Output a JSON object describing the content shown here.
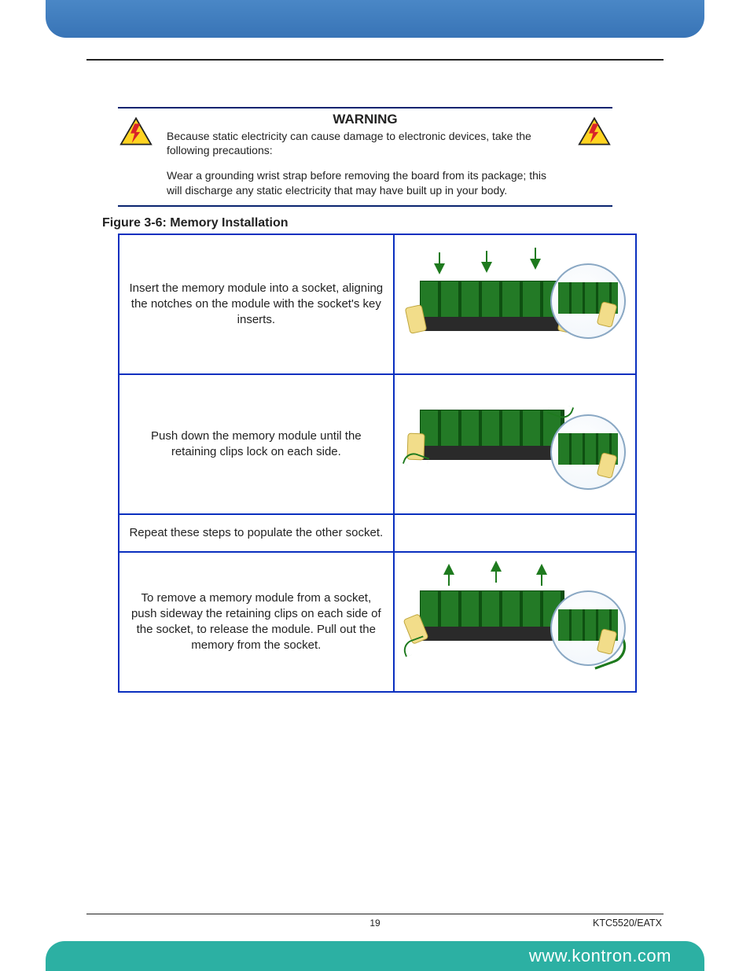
{
  "warning": {
    "title": "WARNING",
    "intro": "Because static electricity can cause damage to electronic devices, take the following precautions:",
    "detail": "Wear a grounding wrist strap before removing the board from its package; this will discharge any static electricity that may have built up in your body.",
    "icon_name": "warning-lightning-icon"
  },
  "figure": {
    "caption": "Figure 3-6: Memory Installation"
  },
  "steps": [
    {
      "text": "Insert the memory module into a socket, aligning the notches on the module with the socket's key inserts.",
      "arrows": "down"
    },
    {
      "text": "Push down the memory module until the retaining clips lock on each side.",
      "arrows": "inward"
    },
    {
      "text": "Repeat these steps to populate the other socket.",
      "arrows": "none"
    },
    {
      "text": "To remove a memory module from a socket, push sideway the retaining clips on each side of the socket, to release the module. Pull out the memory from the socket.",
      "arrows": "up-out"
    }
  ],
  "footer": {
    "page_number": "19",
    "doc_code": "KTC5520/EATX",
    "site_url": "www.kontron.com"
  }
}
